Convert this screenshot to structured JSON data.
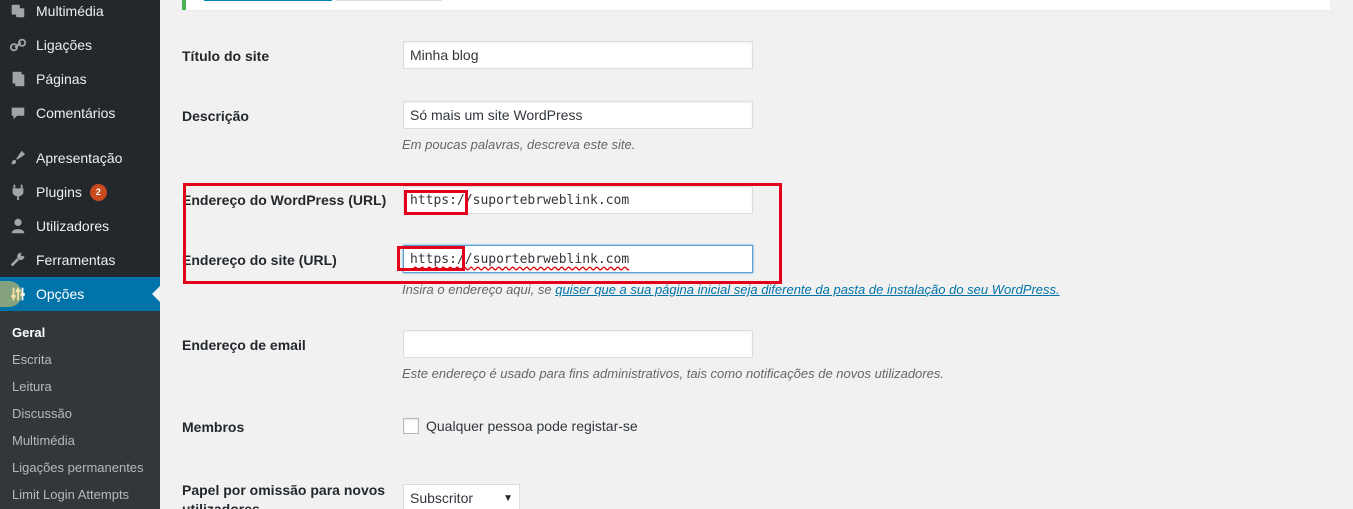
{
  "sidebar": {
    "items": [
      {
        "label": "Multimédia",
        "icon": "media-icon"
      },
      {
        "label": "Ligações",
        "icon": "link-icon"
      },
      {
        "label": "Páginas",
        "icon": "pages-icon"
      },
      {
        "label": "Comentários",
        "icon": "comments-icon"
      },
      {
        "label": "Apresentação",
        "icon": "appearance-brush-icon"
      },
      {
        "label": "Plugins",
        "icon": "plugins-icon",
        "badge": "2"
      },
      {
        "label": "Utilizadores",
        "icon": "users-icon"
      },
      {
        "label": "Ferramentas",
        "icon": "tools-wrench-icon"
      },
      {
        "label": "Opções",
        "icon": "settings-sliders-icon",
        "active": true
      }
    ],
    "submenu": [
      "Geral",
      "Escrita",
      "Leitura",
      "Discussão",
      "Multimédia",
      "Ligações permanentes",
      "Limit Login Attempts"
    ]
  },
  "form": {
    "site_title": {
      "label": "Título do site",
      "value": "Minha blog"
    },
    "tagline": {
      "label": "Descrição",
      "value": "Só mais um site WordPress",
      "description": "Em poucas palavras, descreva este site."
    },
    "wp_url": {
      "label": "Endereço do WordPress (URL)",
      "value_prefix": "https://",
      "value_rest": "suportebrweblink.com"
    },
    "site_url": {
      "label": "Endereço do site (URL)",
      "value_prefix": "https://",
      "value_rest": "suportebrweblink.com",
      "description_prefix": "Insira o endereço aqui, se ",
      "description_link": "quiser que a sua página inicial seja diferente da pasta de instalação do seu WordPress."
    },
    "email": {
      "label": "Endereço de email",
      "value": "",
      "description": "Este endereço é usado para fins administrativos, tais como notificações de novos utilizadores."
    },
    "membership": {
      "label": "Membros",
      "checkbox_label": "Qualquer pessoa pode registar-se",
      "checked": false
    },
    "default_role": {
      "label": "Papel por omissão para novos utilizadores",
      "selected": "Subscritor"
    }
  },
  "colors": {
    "sidebar": "#23282d",
    "active": "#0073aa",
    "highlight_box": "#e3001b",
    "badge": "#ca4a1f"
  }
}
